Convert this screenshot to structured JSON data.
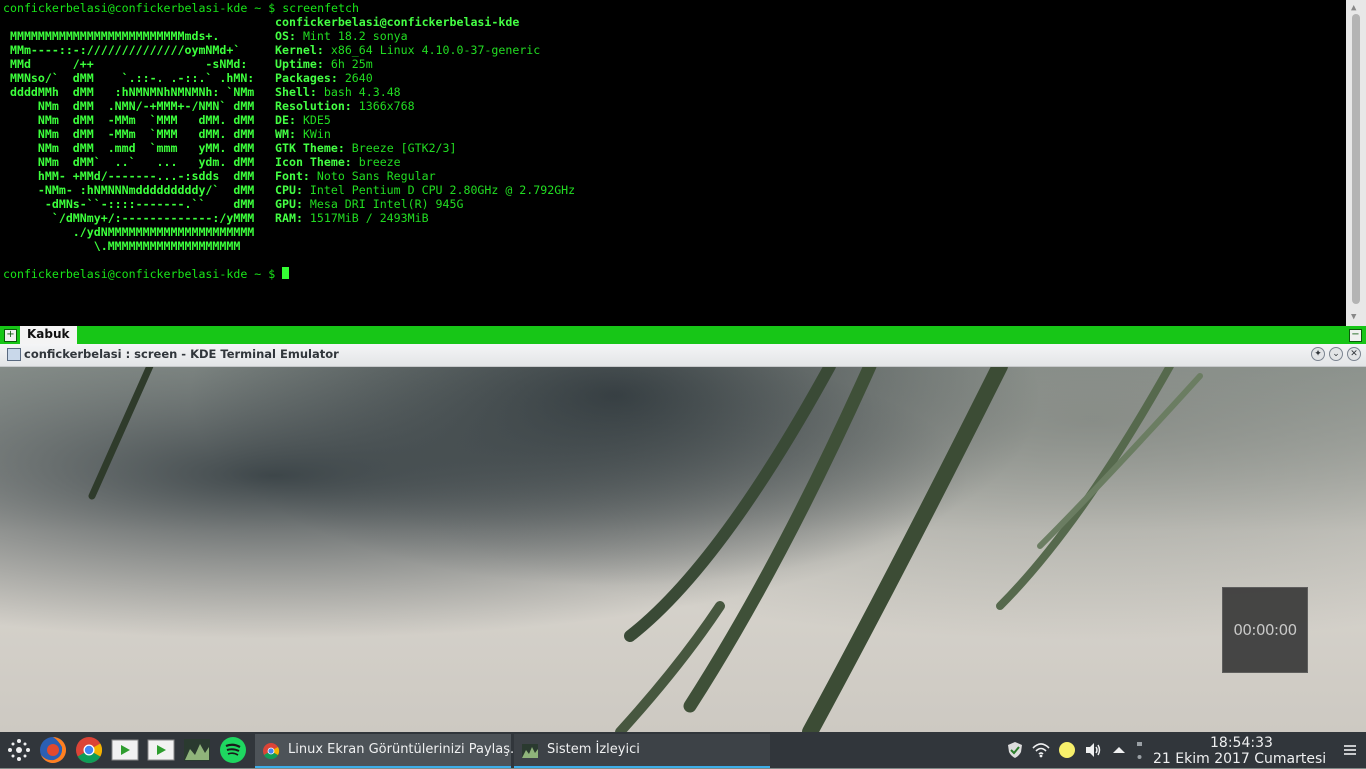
{
  "terminal": {
    "command_line": "confickerbelasi@confickerbelasi-kde ~ $ screenfetch",
    "prompt_line": "confickerbelasi@confickerbelasi-kde ~ $ ",
    "logo": [
      " MMMMMMMMMMMMMMMMMMMMMMMMMmds+.",
      " MMm----::-://////////////oymNMd+`",
      " MMd      /++                -sNMd:",
      " MMNso/`  dMM    `.::-. .-::.` .hMN:",
      " ddddMMh  dMM   :hNMNMNhNMNMNh: `NMm",
      "     NMm  dMM  .NMN/-+MMM+-/NMN` dMM",
      "     NMm  dMM  -MMm  `MMM   dMM. dMM",
      "     NMm  dMM  -MMm  `MMM   dMM. dMM",
      "     NMm  dMM  .mmd  `mmm   yMM. dMM",
      "     NMm  dMM`  ..`   ...   ydm. dMM",
      "     hMM- +MMd/-------...-:sdds  dMM",
      "     -NMm- :hNMNNNmdddddddddy/`  dMM",
      "      -dMNs-``-::::-------.``    dMM",
      "       `/dMNmy+/:-------------:/yMMM",
      "          ./ydNMMMMMMMMMMMMMMMMMMMMM",
      "             \\.MMMMMMMMMMMMMMMMMMM"
    ],
    "host": "confickerbelasi@confickerbelasi-kde",
    "info": [
      {
        "key": "OS:",
        "value": "Mint 18.2 sonya"
      },
      {
        "key": "Kernel:",
        "value": "x86_64 Linux 4.10.0-37-generic"
      },
      {
        "key": "Uptime:",
        "value": "6h 25m"
      },
      {
        "key": "Packages:",
        "value": "2640"
      },
      {
        "key": "Shell:",
        "value": "bash 4.3.48"
      },
      {
        "key": "Resolution:",
        "value": "1366x768"
      },
      {
        "key": "DE:",
        "value": "KDE5"
      },
      {
        "key": "WM:",
        "value": "KWin"
      },
      {
        "key": "GTK Theme:",
        "value": "Breeze [GTK2/3]"
      },
      {
        "key": "Icon Theme:",
        "value": "breeze"
      },
      {
        "key": "Font:",
        "value": "Noto Sans Regular"
      },
      {
        "key": "CPU:",
        "value": "Intel Pentium D CPU 2.80GHz @ 2.792GHz"
      },
      {
        "key": "GPU:",
        "value": "Mesa DRI Intel(R) 945G"
      },
      {
        "key": "RAM:",
        "value": "1517MiB / 2493MiB"
      }
    ]
  },
  "tabbar": {
    "new_tab_symbol": "+",
    "tab_label": "Kabuk",
    "close_symbol": "−"
  },
  "window": {
    "title": "confickerbelasi : screen - KDE Terminal Emulator",
    "btn_keep_above": "✦",
    "btn_minimize": "⌄",
    "btn_close": "✕"
  },
  "timer": {
    "text": "00:00:00"
  },
  "taskbar": {
    "launchers": [
      "application-menu-icon",
      "firefox-icon",
      "chrome-icon",
      "media-player-icon",
      "media-player-2-icon",
      "system-monitor-icon",
      "spotify-icon"
    ],
    "tasks": [
      {
        "label": "Linux Ekran Görüntülerinizi Paylaş...",
        "icon": "chrome-icon"
      },
      {
        "label": "Sistem İzleyici",
        "icon": "system-monitor-icon"
      }
    ],
    "clock_time": "18:54:33",
    "clock_date": "21 Ekim 2017 Cumartesi",
    "colors": {
      "background": "#31363b",
      "accent": "#3daee9",
      "terminal_green": "#19e619"
    }
  }
}
